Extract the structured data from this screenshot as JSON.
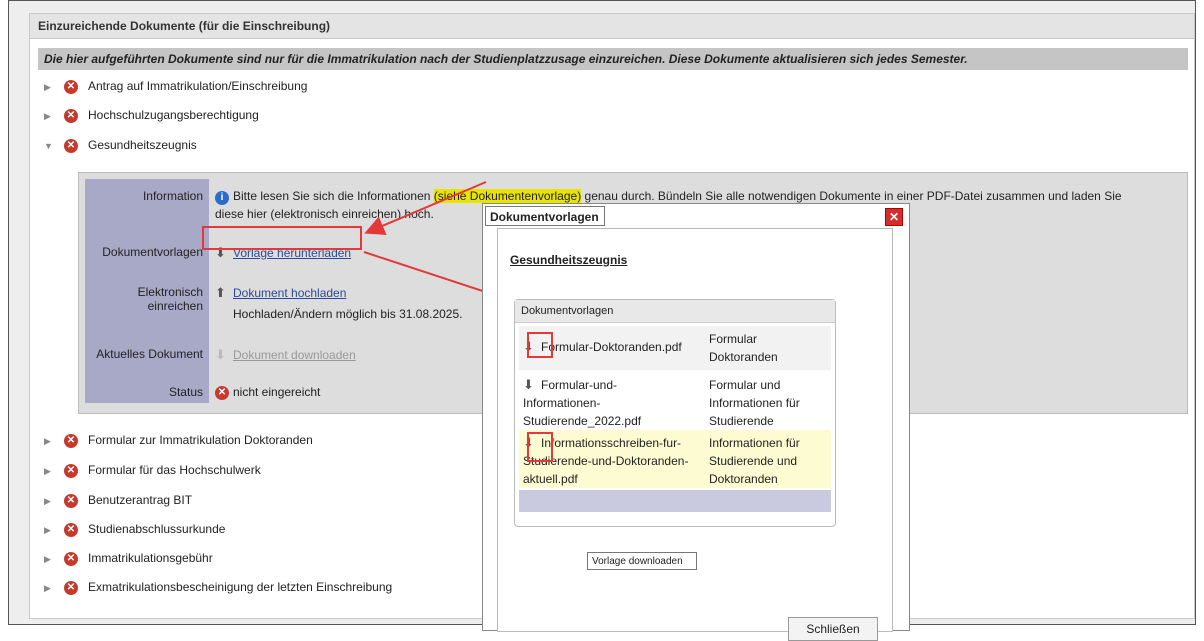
{
  "panel": {
    "title": "Einzureichende Dokumente (für die Einschreibung)",
    "notice": "Die hier aufgeführten Dokumente sind nur für die Immatrikulation nach der Studienplatzzusage einzureichen. Diese Dokumente aktualisieren sich jedes Semester."
  },
  "documents_top": [
    {
      "label": "Antrag auf Immatrikulation/Einschreibung"
    },
    {
      "label": "Hochschulzugangsberechtigung"
    },
    {
      "label": "Gesundheitszeugnis"
    }
  ],
  "detail": {
    "information_label": "Information",
    "information_text_1": "Bitte lesen Sie sich die Informationen ",
    "information_highlight": "(siehe Dokumentenvorlage)",
    "information_text_2": " genau durch. Bündeln Sie alle notwendigen Dokumente in einer PDF-Datei zusammen und laden Sie",
    "information_text_3": "diese hier (elektronisch einreichen) hoch.",
    "templates_label": "Dokumentvorlagen",
    "templates_link": "Vorlage herunterladen",
    "submit_label": "Elektronisch einreichen",
    "submit_link": "Dokument hochladen",
    "submit_note": "Hochladen/Ändern möglich bis 31.08.2025.",
    "current_label": "Aktuelles Dokument",
    "current_link": "Dokument downloaden",
    "status_label": "Status",
    "status_value": "nicht eingereicht"
  },
  "documents_bottom": [
    {
      "label": "Formular zur Immatrikulation Doktoranden"
    },
    {
      "label": "Formular für das Hochschulwerk"
    },
    {
      "label": "Benutzerantrag BIT"
    },
    {
      "label": "Studienabschlussurkunde"
    },
    {
      "label": "Immatrikulationsgebühr"
    },
    {
      "label": "Exmatrikulationsbescheinigung der letzten Einschreibung"
    }
  ],
  "dialog": {
    "title": "Dokumentvorlagen",
    "heading": "Gesundheitszeugnis",
    "table_title": "Dokumentvorlagen",
    "rows": [
      {
        "file": "Formular-Doktoranden.pdf",
        "desc": "Formular Doktoranden"
      },
      {
        "file": "Formular-und-Informationen-Studierende_2022.pdf",
        "desc": "Formular und Informationen für Studierende"
      },
      {
        "file": "Informationsschreiben-fur-Studierende-und-Doktoranden-aktuell.pdf",
        "desc": "Informationen für Studierende und Doktoranden"
      }
    ],
    "tooltip": "Vorlage downloaden",
    "close_button": "Schließen"
  },
  "colors": {
    "accent_red": "#e23a3a",
    "link": "#2a4a9a",
    "highlight": "#e8e400",
    "label_bg": "#a7a9c7"
  }
}
